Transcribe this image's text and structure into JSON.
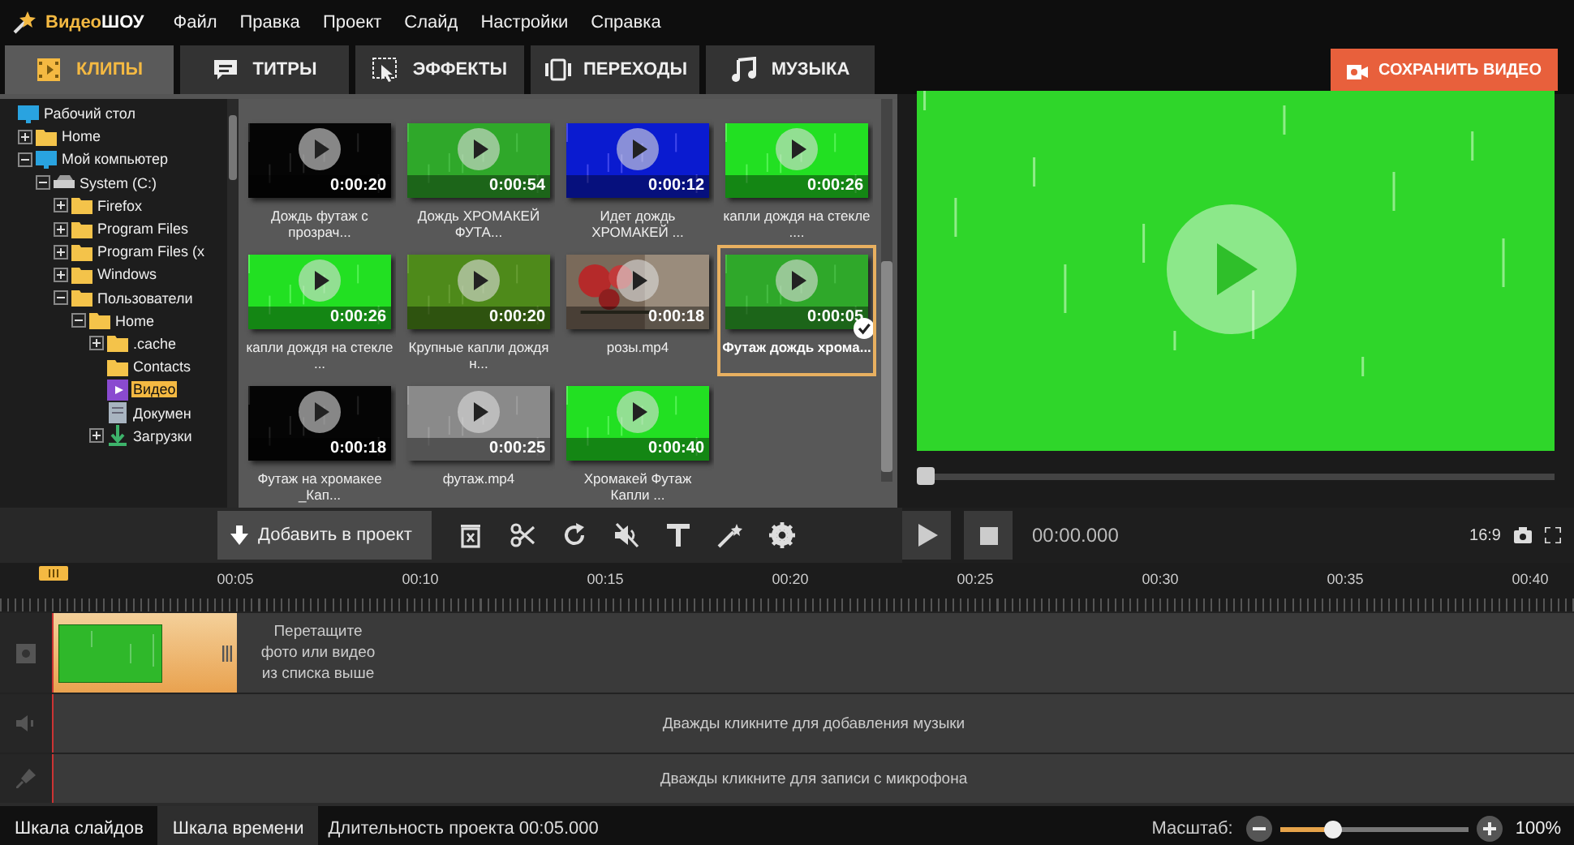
{
  "app": {
    "brand_first": "Видео",
    "brand_second": "ШОУ"
  },
  "menu": [
    "Файл",
    "Правка",
    "Проект",
    "Слайд",
    "Настройки",
    "Справка"
  ],
  "tabs": [
    {
      "label": "КЛИПЫ",
      "kind": "clips",
      "selected": true
    },
    {
      "label": "ТИТРЫ",
      "kind": "titles",
      "selected": false
    },
    {
      "label": "ЭФФЕКТЫ",
      "kind": "effects",
      "selected": false
    },
    {
      "label": "ПЕРЕХОДЫ",
      "kind": "transitions",
      "selected": false
    },
    {
      "label": "МУЗЫКА",
      "kind": "music",
      "selected": false
    }
  ],
  "save_button": "СОХРАНИТЬ ВИДЕО",
  "tree": [
    {
      "label": "Рабочий стол",
      "kind": "monitor",
      "selected": false,
      "children": [
        {
          "label": "Home",
          "kind": "folder",
          "expanded": false,
          "selected": false
        },
        {
          "label": "Мой компьютер",
          "kind": "monitor",
          "expanded": true,
          "selected": false,
          "children": [
            {
              "label": "System  (C:)",
              "kind": "drive",
              "expanded": true,
              "selected": false,
              "children": [
                {
                  "label": "Firefox",
                  "kind": "folder",
                  "expanded": false,
                  "selected": false
                },
                {
                  "label": "Program Files",
                  "kind": "folder",
                  "expanded": false,
                  "selected": false
                },
                {
                  "label": "Program Files (x",
                  "kind": "folder",
                  "expanded": false,
                  "selected": false
                },
                {
                  "label": "Windows",
                  "kind": "folder",
                  "expanded": false,
                  "selected": false
                },
                {
                  "label": "Пользователи",
                  "kind": "folder",
                  "expanded": true,
                  "selected": false,
                  "children": [
                    {
                      "label": "Home",
                      "kind": "folder",
                      "expanded": true,
                      "selected": false,
                      "children": [
                        {
                          "label": ".cache",
                          "kind": "folder",
                          "expanded": false,
                          "selected": false
                        },
                        {
                          "label": "Contacts",
                          "kind": "folder",
                          "selected": false
                        },
                        {
                          "label": "Видео",
                          "kind": "video",
                          "selected": true
                        },
                        {
                          "label": "Докумен",
                          "kind": "document",
                          "selected": false
                        },
                        {
                          "label": "Загрузки",
                          "kind": "download",
                          "expanded": false,
                          "selected": false
                        }
                      ]
                    }
                  ]
                }
              ]
            }
          ]
        }
      ]
    }
  ],
  "clips": [
    {
      "title": "Дождь футаж с прозрач...",
      "duration": "0:00:20",
      "kind": "black",
      "selected": false
    },
    {
      "title": "Дождь ХРОМАКЕЙ ФУТА...",
      "duration": "0:00:54",
      "kind": "green",
      "selected": false
    },
    {
      "title": "Идет дождь ХРОМАКЕЙ ...",
      "duration": "0:00:12",
      "kind": "blue",
      "selected": false
    },
    {
      "title": "капли дождя на стекле ....",
      "duration": "0:00:26",
      "kind": "lime",
      "selected": false
    },
    {
      "title": "капли дождя на стекле ...",
      "duration": "0:00:26",
      "kind": "lime",
      "selected": false
    },
    {
      "title": "Крупные капли дождя н...",
      "duration": "0:00:20",
      "kind": "olive",
      "selected": false
    },
    {
      "title": "розы.mp4",
      "duration": "0:00:18",
      "selected": false
    },
    {
      "title": "Футаж дождь хрома...",
      "duration": "0:00:05",
      "kind": "green",
      "selected": true
    },
    {
      "title": "Футаж на хромакее _Кап...",
      "duration": "0:00:18",
      "kind": "black",
      "selected": false
    },
    {
      "title": "футаж.mp4",
      "duration": "0:00:25",
      "kind": "gray",
      "selected": false
    },
    {
      "title": "Хромакей Футаж Капли ...",
      "duration": "0:00:40",
      "kind": "lime",
      "selected": false
    }
  ],
  "toolbar": {
    "add_button": "Добавить в проект"
  },
  "player": {
    "seek": {
      "level": 0
    },
    "time": "00:00.000",
    "aspect": "16:9"
  },
  "timeline": {
    "ticks": [
      "00:05",
      "00:10",
      "00:15",
      "00:20",
      "00:25",
      "00:30",
      "00:35",
      "00:40"
    ],
    "hint_lines": [
      "Перетащите",
      "фото или видео",
      "из списка выше"
    ],
    "music_hint": "Дважды кликните для добавления музыки",
    "mic_hint": "Дважды кликните для записи с микрофона"
  },
  "status_bar": {
    "tabs": [
      {
        "label": "Шкала слайдов",
        "selected": false
      },
      {
        "label": "Шкала времени",
        "selected": true
      }
    ],
    "duration": "Длительность проекта 00:05.000",
    "zoom_label": "Масштаб:",
    "zoom": {
      "level": 0.28
    },
    "zoom_value": "100%"
  }
}
